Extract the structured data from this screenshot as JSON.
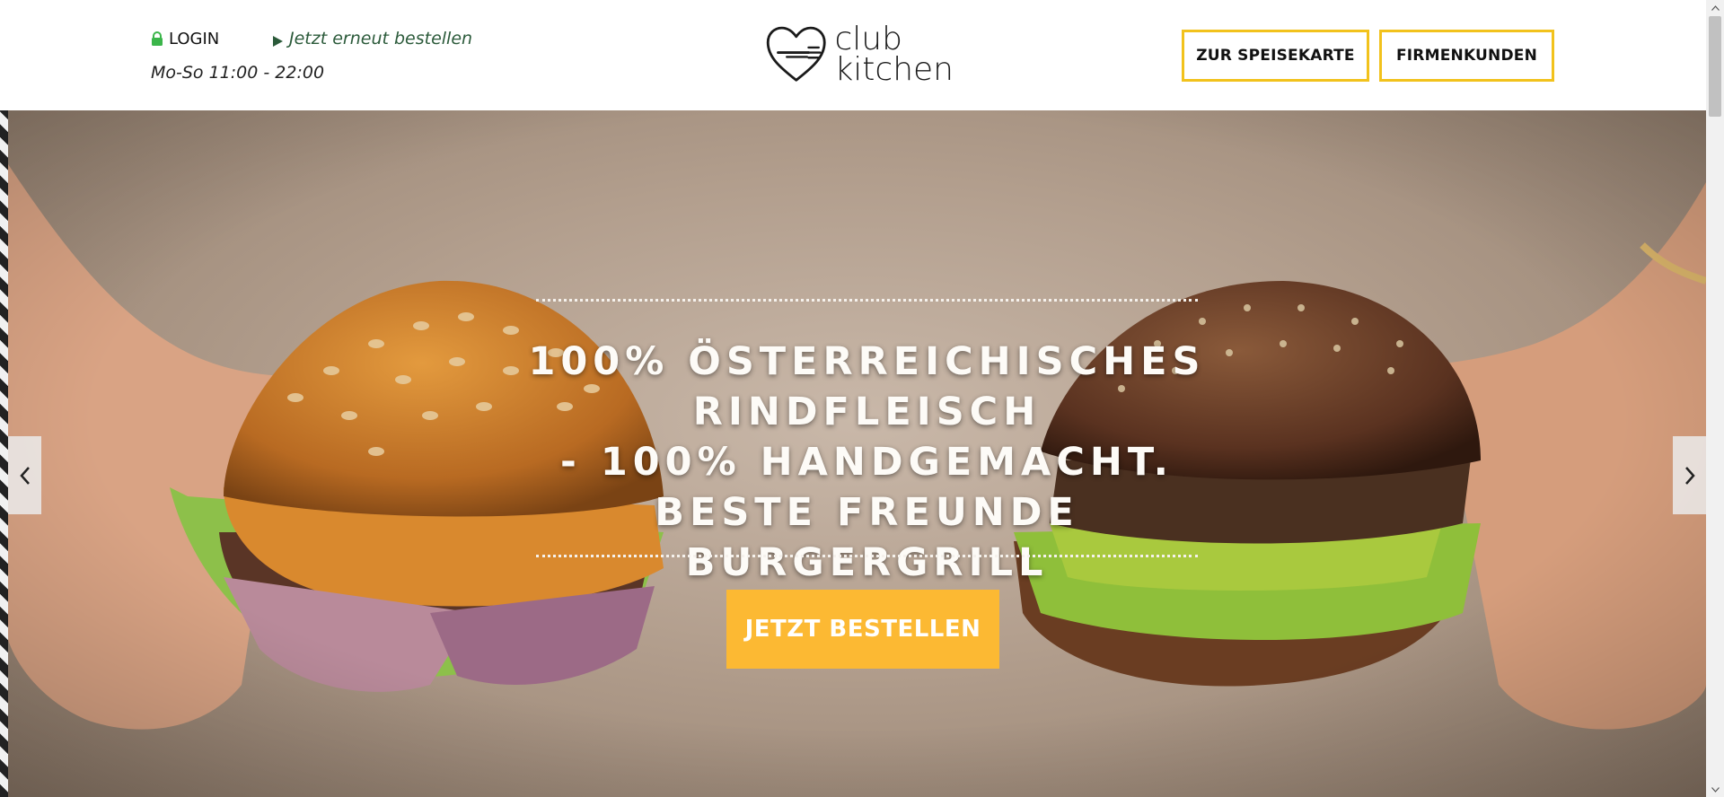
{
  "header": {
    "login_label": "LOGIN",
    "reorder_label": "Jetzt erneut bestellen",
    "hours": "Mo-So 11:00 - 22:00",
    "logo": {
      "line1": "club",
      "line2": "kitchen"
    },
    "nav": {
      "menu_label": "ZUR SPEISEKARTE",
      "business_label": "FIRMENKUNDEN"
    }
  },
  "hero": {
    "headline_lines": [
      "100% ÖSTERREICHISCHES",
      "RINDFLEISCH",
      "- 100% HANDGEMACHT.",
      "BESTE FREUNDE BURGERGRILL"
    ],
    "cta_label": "JETZT BESTELLEN"
  },
  "icons": {
    "lock": "lock-icon",
    "play": "play-icon",
    "prev": "chevron-left-icon",
    "next": "chevron-right-icon"
  },
  "colors": {
    "accent_yellow": "#f2c21c",
    "cta_orange": "#fcb933",
    "login_lock_green": "#3bb54a",
    "reorder_text_green": "#2b5a3a"
  }
}
